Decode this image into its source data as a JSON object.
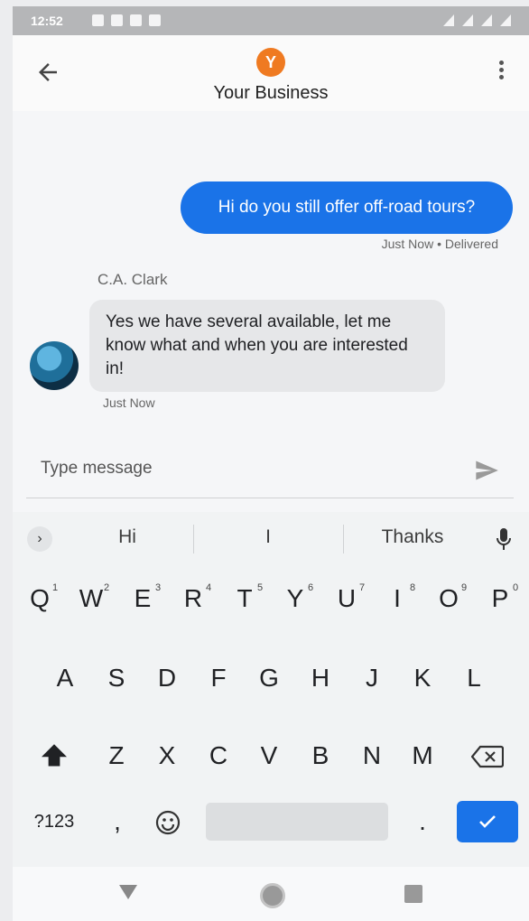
{
  "status_bar": {
    "time": "12:52"
  },
  "header": {
    "logo_letter": "Y",
    "title": "Your Business"
  },
  "messages": {
    "outgoing": {
      "text": "Hi do you still offer off-road tours?",
      "meta": "Just Now • Delivered"
    },
    "incoming": {
      "sender": "C.A. Clark",
      "text": "Yes we have several available, let me know what and when you are interested in!",
      "meta": "Just Now"
    }
  },
  "compose": {
    "placeholder": "Type message"
  },
  "keyboard": {
    "suggestions": [
      "Hi",
      "I",
      "Thanks"
    ],
    "row1": [
      "Q",
      "W",
      "E",
      "R",
      "T",
      "Y",
      "U",
      "I",
      "O",
      "P"
    ],
    "row1_hints": [
      "1",
      "2",
      "3",
      "4",
      "5",
      "6",
      "7",
      "8",
      "9",
      "0"
    ],
    "row2": [
      "A",
      "S",
      "D",
      "F",
      "G",
      "H",
      "J",
      "K",
      "L"
    ],
    "row3": [
      "Z",
      "X",
      "C",
      "V",
      "B",
      "N",
      "M"
    ],
    "row4": {
      "symbols": "?123",
      "comma": ",",
      "period": "."
    }
  },
  "colors": {
    "accent": "#1a73e8",
    "logo": "#ef7a21"
  },
  "icons": [
    "back-arrow-icon",
    "more-vert-icon",
    "send-icon",
    "chevron-right-icon",
    "mic-icon",
    "shift-icon",
    "backspace-icon",
    "emoji-icon",
    "check-icon"
  ]
}
